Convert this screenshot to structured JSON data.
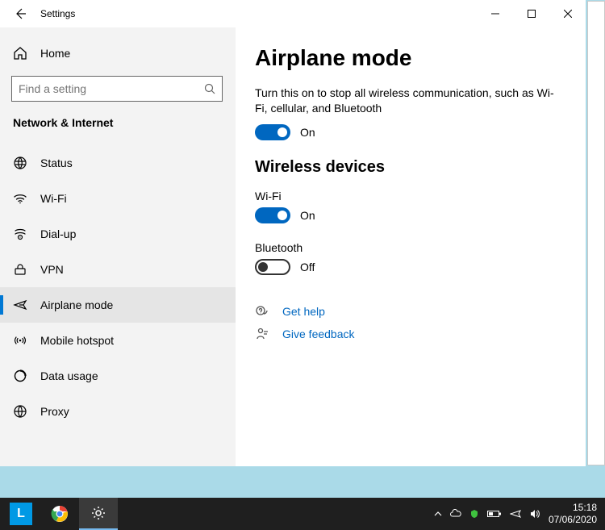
{
  "window": {
    "title": "Settings"
  },
  "sidebar": {
    "home_label": "Home",
    "search_placeholder": "Find a setting",
    "category": "Network & Internet",
    "items": [
      {
        "label": "Status"
      },
      {
        "label": "Wi-Fi"
      },
      {
        "label": "Dial-up"
      },
      {
        "label": "VPN"
      },
      {
        "label": "Airplane mode",
        "active": true
      },
      {
        "label": "Mobile hotspot"
      },
      {
        "label": "Data usage"
      },
      {
        "label": "Proxy"
      }
    ]
  },
  "content": {
    "title": "Airplane mode",
    "description": "Turn this on to stop all wireless communication, such as Wi-Fi, cellular, and Bluetooth",
    "airplane": {
      "state_label": "On",
      "on": true
    },
    "devices_heading": "Wireless devices",
    "wifi": {
      "label": "Wi-Fi",
      "state_label": "On",
      "on": true
    },
    "bluetooth": {
      "label": "Bluetooth",
      "state_label": "Off",
      "on": false
    },
    "links": {
      "help": "Get help",
      "feedback": "Give feedback"
    }
  },
  "taskbar": {
    "time": "15:18",
    "date": "07/06/2020"
  }
}
